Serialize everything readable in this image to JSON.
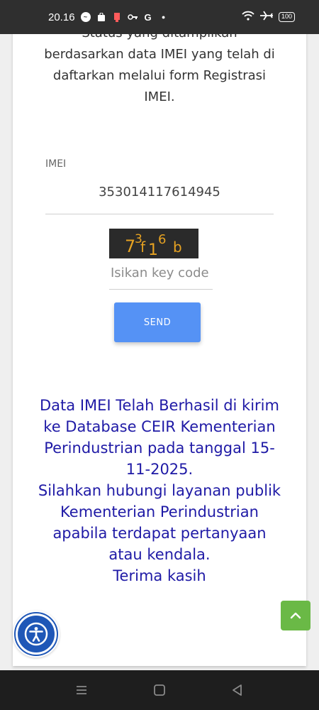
{
  "status_bar": {
    "time": "20.16",
    "battery": "100",
    "icons": [
      "messenger-icon",
      "shopping-bag-icon",
      "notification-icon",
      "key-icon",
      "google-icon",
      "dot-icon",
      "wifi-icon",
      "airplane-icon",
      "battery-icon"
    ]
  },
  "page": {
    "intro_text": "Status yang ditampilkan berdasarkan data IMEI yang telah di daftarkan melalui form Registrasi IMEI.",
    "imei_label": "IMEI",
    "imei_value": "353014117614945",
    "captcha_text": "73f16b",
    "keycode_placeholder": "Isikan key code",
    "send_label": "SEND",
    "result_message": "Data IMEI Telah Berhasil di kirim ke Database CEIR Kementerian Perindustrian pada tanggal 15-11-2025.",
    "followup_message": "Silahkan hubungi layanan publik Kementerian Perindustrian apabila terdapat pertanyaan atau kendala.",
    "thanks_message": "Terima kasih"
  },
  "colors": {
    "send_button": "#5592f5",
    "message_text": "#1f1aa6",
    "scroll_top": "#6ab946",
    "accessibility": "#1f57b7"
  },
  "nav_bar": {
    "icons": [
      "menu-icon",
      "home-icon",
      "back-icon"
    ]
  }
}
